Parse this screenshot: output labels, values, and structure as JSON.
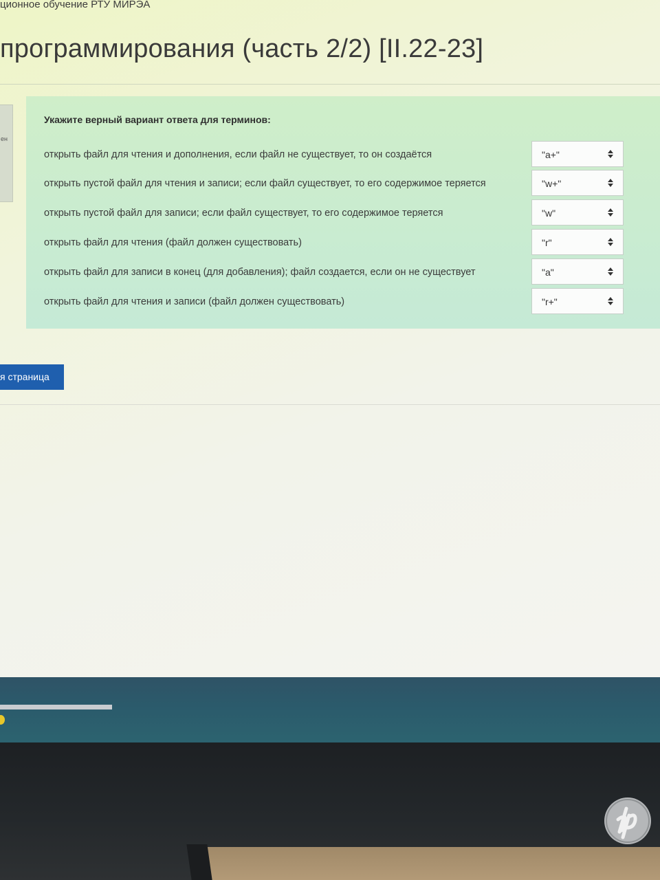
{
  "header": {
    "site_name": "ционное обучение РТУ МИРЭА",
    "course_title": "программирования (часть 2/2) [II.22-23]"
  },
  "left_tab": {
    "label": "ен"
  },
  "question": {
    "prompt": "Укажите верный вариант ответа для терминов:",
    "rows": [
      {
        "term": "открыть файл для чтения и дополнения, если файл не существует, то он создаётся",
        "answer": "\"a+\""
      },
      {
        "term": "открыть пустой файл для чтения и записи; если файл существует, то его содержимое теряется",
        "answer": "\"w+\""
      },
      {
        "term": "открыть пустой файл для записи; если файл существует, то его содержимое теряется",
        "answer": "\"w\""
      },
      {
        "term": "открыть файл для чтения (файл должен существовать)",
        "answer": "\"r\""
      },
      {
        "term": "открыть файл для записи в конец (для добавления); файл создается, если он не существует",
        "answer": "\"a\""
      },
      {
        "term": "открыть файл для чтения и записи (файл должен существовать)",
        "answer": "\"r+\""
      }
    ]
  },
  "navigation": {
    "next_label": "я страница"
  },
  "colors": {
    "question_bg": "#cfeec9",
    "button_bg": "#1f5fae",
    "taskbar": "#2c5a6b"
  },
  "icons": {
    "select_arrow": "up-down-arrow-icon",
    "brand": "hp-logo-icon"
  }
}
